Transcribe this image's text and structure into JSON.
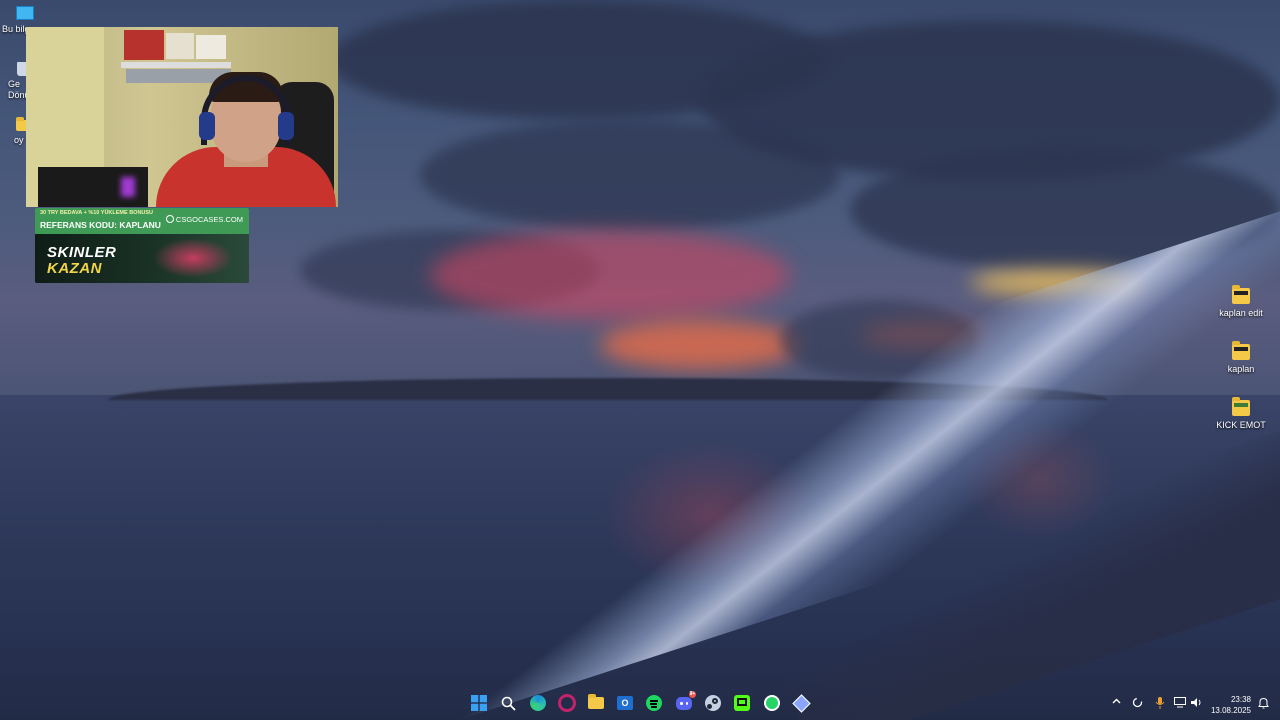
{
  "desktop": {
    "left_icons": [
      {
        "label": "Bu bilg",
        "icon": "computer-icon"
      },
      {
        "label": "Ge\nDönü",
        "icon": "recycle-bin-icon"
      },
      {
        "label": "oy",
        "icon": "folder-icon"
      }
    ],
    "right_icons": [
      {
        "label": "kaplan edit",
        "icon": "folder-icon"
      },
      {
        "label": "kaplan",
        "icon": "folder-icon"
      },
      {
        "label": "KICK EMOT",
        "icon": "folder-icon"
      }
    ]
  },
  "ad": {
    "line1": "30 TRY BEDAVA + %10 YÜKLEME BONUSU",
    "line2": "REFERANS KODU: KAPLANU",
    "brand": "CSGOCASES.COM",
    "headline1": "SKINLER",
    "headline2": "KAZAN"
  },
  "taskbar": {
    "apps": [
      {
        "name": "start-button",
        "icon": "windows-icon",
        "color": "#3aa0f2"
      },
      {
        "name": "search-button",
        "icon": "search-icon",
        "color": "#ffffff"
      },
      {
        "name": "edge-app",
        "icon": "edge-icon",
        "color": "#2fb3a8"
      },
      {
        "name": "app-ring",
        "icon": "circle-app-icon",
        "color": "#c2236d"
      },
      {
        "name": "explorer-app",
        "icon": "folder-icon",
        "color": "#f3c947"
      },
      {
        "name": "outlook-app",
        "icon": "outlook-icon",
        "color": "#1e6fd0"
      },
      {
        "name": "spotify-app",
        "icon": "spotify-icon",
        "color": "#1ed760"
      },
      {
        "name": "discord-app",
        "icon": "discord-icon",
        "color": "#5865f2"
      },
      {
        "name": "steam-app",
        "icon": "steam-icon",
        "color": "#1b2838"
      },
      {
        "name": "kick-app",
        "icon": "kick-icon",
        "color": "#53fc18"
      },
      {
        "name": "whatsapp-app",
        "icon": "whatsapp-icon",
        "color": "#25d366"
      },
      {
        "name": "app-diamond",
        "icon": "diamond-app-icon",
        "color": "#8aa6ff"
      }
    ],
    "discord_badge": "9+",
    "clock": {
      "time": "23:38",
      "date": "13.08.2025"
    }
  }
}
